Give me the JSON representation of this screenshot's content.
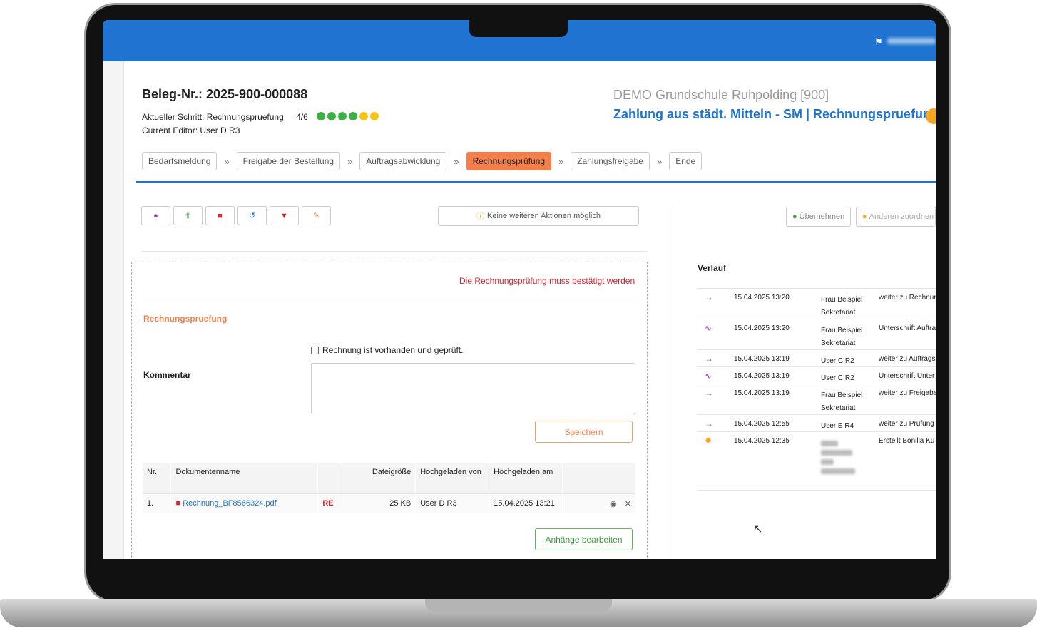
{
  "header": {
    "doc_title": "Beleg-Nr.: 2025-900-000088",
    "current_step": "Aktueller Schritt: Rechnungspruefung",
    "progress": "4/6",
    "current_editor": "Current Editor: User D R3",
    "school": "DEMO Grundschule Ruhpolding [900]",
    "workflow": "Zahlung aus städt. Mitteln - SM | Rechnungspruefung"
  },
  "progress_dots": [
    "#3cb043",
    "#3cb043",
    "#3cb043",
    "#3cb043",
    "#f5c518",
    "#f5c518"
  ],
  "steps": [
    {
      "label": "Bedarfsmeldung",
      "active": false
    },
    {
      "label": "Freigabe der Bestellung",
      "active": false
    },
    {
      "label": "Auftragsabwicklung",
      "active": false
    },
    {
      "label": "Rechnungsprüfung",
      "active": true
    },
    {
      "label": "Zahlungsfreigabe",
      "active": false
    },
    {
      "label": "Ende",
      "active": false
    }
  ],
  "step_separator": "»",
  "toolbar": {
    "icons": [
      "comment-icon",
      "upload-icon",
      "pdf-icon",
      "undo-icon",
      "thumbs-down-icon",
      "edit-icon"
    ],
    "no_actions": "Keine weiteren Aktionen möglich",
    "take_over": "Übernehmen",
    "assign_other": "Anderen zuordnen"
  },
  "form": {
    "warning": "Die Rechnungsprüfung muss bestätigt werden",
    "section_title": "Rechnungspruefung",
    "checkbox_label": "Rechnung ist vorhanden und geprüft.",
    "comment_label": "Kommentar",
    "comment_value": "",
    "save_label": "Speichern",
    "attach_label": "Anhänge bearbeiten"
  },
  "documents": {
    "headers": [
      "Nr.",
      "Dokumentenname",
      "",
      "Dateigröße",
      "Hochgeladen von",
      "Hochgeladen am",
      ""
    ],
    "rows": [
      {
        "nr": "1.",
        "name": "Rechnung_BF8566324.pdf",
        "tag": "RE",
        "size": "25 KB",
        "by": "User D R3",
        "at": "15.04.2025 13:21"
      }
    ]
  },
  "history": {
    "title": "Verlauf",
    "rows": [
      {
        "icon": "arrow-right-icon",
        "color": "#3c9a3c",
        "date": "15.04.2025 13:20",
        "who": [
          "Frau Beispiel",
          "Sekretariat"
        ],
        "action": "weiter zu Rechnun"
      },
      {
        "icon": "signature-icon",
        "color": "#9b3bb8",
        "date": "15.04.2025 13:20",
        "who": [
          "Frau Beispiel",
          "Sekretariat"
        ],
        "action": "Unterschrift Auftra"
      },
      {
        "icon": "arrow-right-icon",
        "color": "#3c9a3c",
        "date": "15.04.2025 13:19",
        "who": [
          "User C R2"
        ],
        "action": "weiter zu Auftrags"
      },
      {
        "icon": "signature-icon",
        "color": "#9b3bb8",
        "date": "15.04.2025 13:19",
        "who": [
          "User C R2"
        ],
        "action": "Unterschrift Unter"
      },
      {
        "icon": "arrow-right-icon",
        "color": "#3c9a3c",
        "date": "15.04.2025 13:19",
        "who": [
          "Frau Beispiel",
          "Sekretariat"
        ],
        "action": "weiter zu Freigabe"
      },
      {
        "icon": "arrow-right-icon",
        "color": "#3c9a3c",
        "date": "15.04.2025 12:55",
        "who": [
          "User E R4"
        ],
        "action": "weiter zu Prüfung"
      },
      {
        "icon": "sun-icon",
        "color": "#f5a623",
        "date": "15.04.2025 12:35",
        "who": [],
        "action": "Erstellt Bonilla Ku"
      }
    ]
  }
}
